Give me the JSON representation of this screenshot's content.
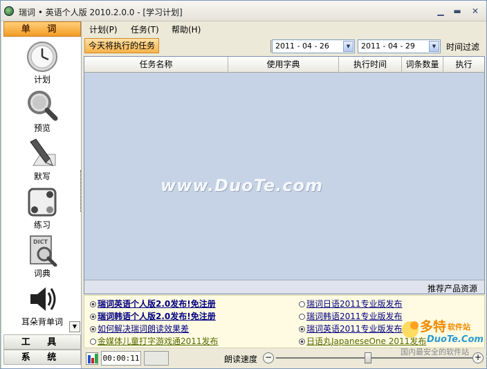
{
  "window": {
    "title": "瑞词 • 英语个人版 2010.2.0.0 - [学习计划]",
    "controls": {
      "minimize": "▁",
      "maximize": "▬",
      "close": "✕"
    }
  },
  "sidebar": {
    "active_section": "单 词",
    "items": [
      {
        "label": "计划",
        "icon": "clock-icon"
      },
      {
        "label": "预览",
        "icon": "magnifier-icon"
      },
      {
        "label": "默写",
        "icon": "pen-icon"
      },
      {
        "label": "练习",
        "icon": "practice-icon"
      },
      {
        "label": "词典",
        "icon": "dictionary-icon"
      },
      {
        "label": "耳朵背单词",
        "icon": "speaker-icon"
      }
    ],
    "tools_section": "工 具",
    "system_section": "系 统"
  },
  "menu": {
    "items": [
      "计划(P)",
      "任务(T)",
      "帮助(H)"
    ]
  },
  "filter": {
    "today_tab": "今天将执行的任务",
    "date_from": "2011 - 04 - 26",
    "date_to": "2011 - 04 - 29",
    "time_filter": "时间过滤"
  },
  "table": {
    "columns": [
      "任务名称",
      "使用字典",
      "执行时间",
      "词条数量",
      "执行"
    ],
    "rows": [],
    "watermark": "www.DuoTe.com"
  },
  "recommend": {
    "label": "推荐产品资源"
  },
  "links": {
    "left": [
      "瑞词英语个人版2.0发布!免注册",
      "瑞词韩语个人版2.0发布!免注册",
      "如何解决瑞词朗读效果差",
      "金媒体儿童打字游戏通2011发布"
    ],
    "right": [
      "瑞词日语2011专业版发布",
      "瑞词韩语2011专业版发布",
      "瑞词英语2011专业版发布",
      "日语丸JapaneseOne 2011发布"
    ]
  },
  "status": {
    "timer": "00:00:11",
    "speed_label": "朗读速度",
    "speed_level": 0.47
  },
  "site_logo": {
    "brand": "多特软件站",
    "domain": "DuoTe.Com",
    "slogan": "国内最安全的软件站"
  },
  "colors": {
    "accent_orange": "#f39b25",
    "table_bg": "#c6d3e6",
    "link_navy": "#000080",
    "link_olive": "#556b00"
  }
}
